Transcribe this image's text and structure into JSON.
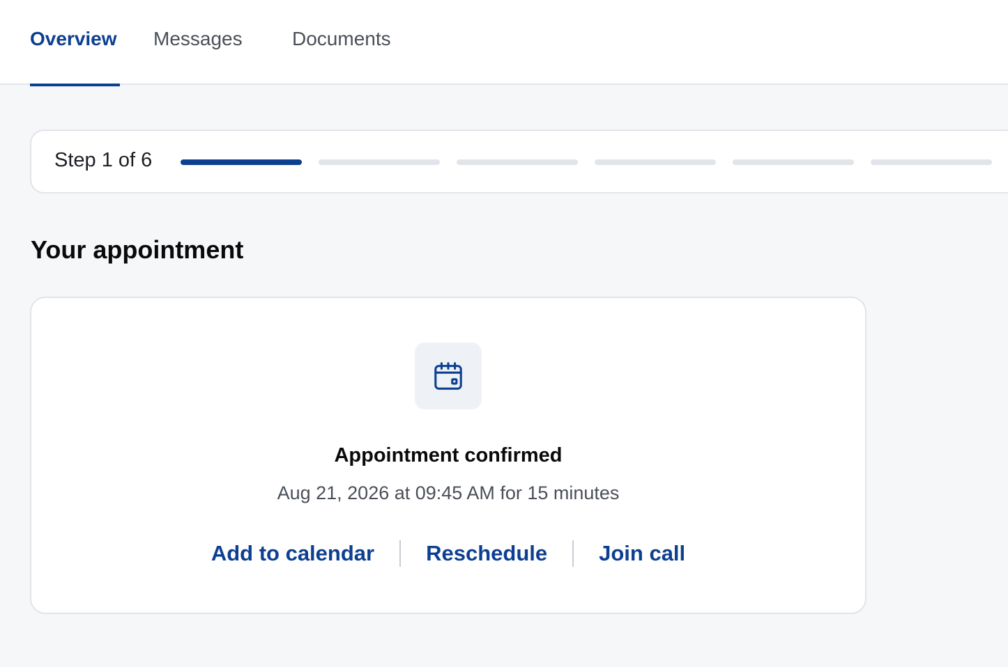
{
  "tabs": [
    {
      "label": "Overview",
      "active": true
    },
    {
      "label": "Messages",
      "active": false
    },
    {
      "label": "Documents",
      "active": false
    }
  ],
  "progress": {
    "label": "Step 1 of 6",
    "current_step": 1,
    "total_steps": 6
  },
  "appointment": {
    "section_title": "Your appointment",
    "icon": "calendar-icon",
    "title": "Appointment confirmed",
    "subtitle": "Aug 21, 2026 at 09:45 AM for 15 minutes",
    "actions": {
      "add_to_calendar": "Add to calendar",
      "reschedule": "Reschedule",
      "join_call": "Join call"
    }
  },
  "colors": {
    "accent": "#0d3f91",
    "page_background": "#f6f7f9",
    "inactive_segment": "#e1e4e8",
    "icon_tile": "#eef2f7"
  }
}
